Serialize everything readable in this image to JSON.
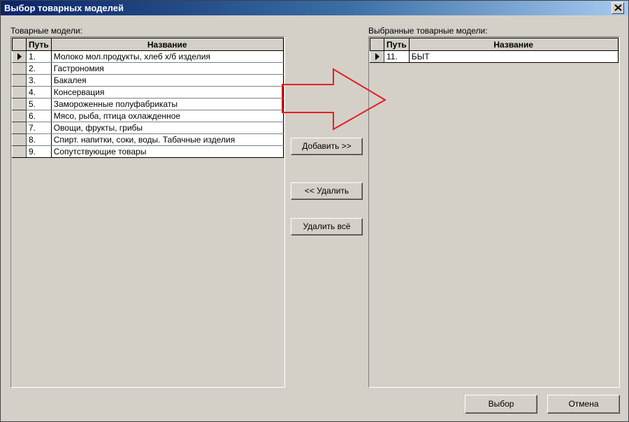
{
  "window": {
    "title": "Выбор товарных моделей"
  },
  "left_panel": {
    "label": "Товарные модели:",
    "columns": [
      "Путь",
      "Название"
    ],
    "rows": [
      {
        "path": "1.",
        "name": "Молоко мол.продукты, хлеб х/б изделия",
        "current": true
      },
      {
        "path": "2.",
        "name": "Гастрономия",
        "current": false
      },
      {
        "path": "3.",
        "name": "Бакалея",
        "current": false
      },
      {
        "path": "4.",
        "name": "Консервация",
        "current": false
      },
      {
        "path": "5.",
        "name": "Замороженные полуфабрикаты",
        "current": false
      },
      {
        "path": "6.",
        "name": "Мясо, рыба, птица охлажденное",
        "current": false
      },
      {
        "path": "7.",
        "name": "Овощи, фрукты, грибы",
        "current": false
      },
      {
        "path": "8.",
        "name": "Спирт. напитки, соки, воды. Табачные изделия",
        "current": false
      },
      {
        "path": "9.",
        "name": "Сопутствующие товары",
        "current": false
      }
    ]
  },
  "right_panel": {
    "label": "Выбранные товарные модели:",
    "columns": [
      "Путь",
      "Название"
    ],
    "rows": [
      {
        "path": "11.",
        "name": "БЫТ",
        "current": true
      }
    ]
  },
  "buttons": {
    "add": "Добавить >>",
    "remove": "<< Удалить",
    "remove_all": "Удалить всё",
    "select": "Выбор",
    "cancel": "Отмена"
  },
  "colors": {
    "annotation_arrow": "#e02020",
    "dialog_bg": "#d4d0c8"
  }
}
